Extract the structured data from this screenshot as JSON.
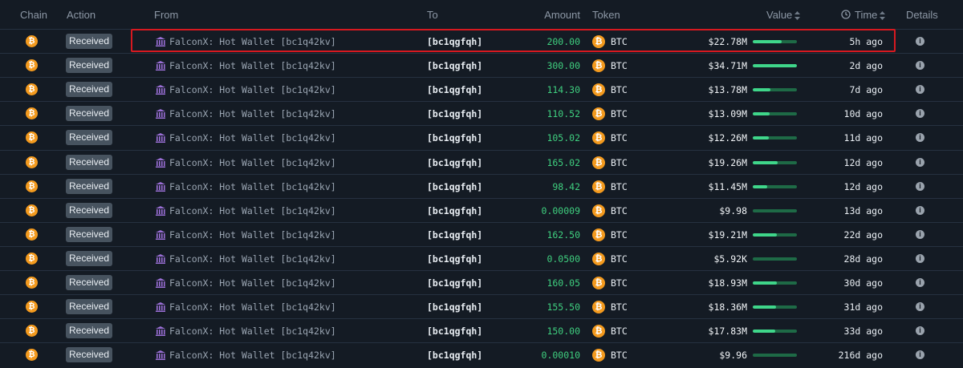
{
  "header": {
    "chain": "Chain",
    "action": "Action",
    "from": "From",
    "to": "To",
    "amount": "Amount",
    "token": "Token",
    "value": "Value",
    "time": "Time",
    "details": "Details"
  },
  "icons": {
    "btc_glyph": "₿",
    "info_glyph": "i"
  },
  "colors": {
    "background": "#141b24",
    "amount_green": "#3fcf7f",
    "btc_orange": "#f39a1e",
    "highlight_red": "#d71920",
    "bar_fill": "#3fd68a"
  },
  "rows": [
    {
      "action": "Received",
      "from": "FalconX: Hot Wallet [bc1q42kv]",
      "to": "[bc1qgfqh]",
      "amount": "200.00",
      "token": "BTC",
      "value": "$22.78M",
      "value_level": 0.66,
      "time": "5h ago"
    },
    {
      "action": "Received",
      "from": "FalconX: Hot Wallet [bc1q42kv]",
      "to": "[bc1qgfqh]",
      "amount": "300.00",
      "token": "BTC",
      "value": "$34.71M",
      "value_level": 1.0,
      "time": "2d ago"
    },
    {
      "action": "Received",
      "from": "FalconX: Hot Wallet [bc1q42kv]",
      "to": "[bc1qgfqh]",
      "amount": "114.30",
      "token": "BTC",
      "value": "$13.78M",
      "value_level": 0.4,
      "time": "7d ago"
    },
    {
      "action": "Received",
      "from": "FalconX: Hot Wallet [bc1q42kv]",
      "to": "[bc1qgfqh]",
      "amount": "110.52",
      "token": "BTC",
      "value": "$13.09M",
      "value_level": 0.38,
      "time": "10d ago"
    },
    {
      "action": "Received",
      "from": "FalconX: Hot Wallet [bc1q42kv]",
      "to": "[bc1qgfqh]",
      "amount": "105.02",
      "token": "BTC",
      "value": "$12.26M",
      "value_level": 0.36,
      "time": "11d ago"
    },
    {
      "action": "Received",
      "from": "FalconX: Hot Wallet [bc1q42kv]",
      "to": "[bc1qgfqh]",
      "amount": "165.02",
      "token": "BTC",
      "value": "$19.26M",
      "value_level": 0.56,
      "time": "12d ago"
    },
    {
      "action": "Received",
      "from": "FalconX: Hot Wallet [bc1q42kv]",
      "to": "[bc1qgfqh]",
      "amount": "98.42",
      "token": "BTC",
      "value": "$11.45M",
      "value_level": 0.33,
      "time": "12d ago"
    },
    {
      "action": "Received",
      "from": "FalconX: Hot Wallet [bc1q42kv]",
      "to": "[bc1qgfqh]",
      "amount": "0.00009",
      "token": "BTC",
      "value": "$9.98",
      "value_level": 0.0,
      "time": "13d ago"
    },
    {
      "action": "Received",
      "from": "FalconX: Hot Wallet [bc1q42kv]",
      "to": "[bc1qgfqh]",
      "amount": "162.50",
      "token": "BTC",
      "value": "$19.21M",
      "value_level": 0.55,
      "time": "22d ago"
    },
    {
      "action": "Received",
      "from": "FalconX: Hot Wallet [bc1q42kv]",
      "to": "[bc1qgfqh]",
      "amount": "0.0500",
      "token": "BTC",
      "value": "$5.92K",
      "value_level": 0.0,
      "time": "28d ago"
    },
    {
      "action": "Received",
      "from": "FalconX: Hot Wallet [bc1q42kv]",
      "to": "[bc1qgfqh]",
      "amount": "160.05",
      "token": "BTC",
      "value": "$18.93M",
      "value_level": 0.55,
      "time": "30d ago"
    },
    {
      "action": "Received",
      "from": "FalconX: Hot Wallet [bc1q42kv]",
      "to": "[bc1qgfqh]",
      "amount": "155.50",
      "token": "BTC",
      "value": "$18.36M",
      "value_level": 0.53,
      "time": "31d ago"
    },
    {
      "action": "Received",
      "from": "FalconX: Hot Wallet [bc1q42kv]",
      "to": "[bc1qgfqh]",
      "amount": "150.00",
      "token": "BTC",
      "value": "$17.83M",
      "value_level": 0.51,
      "time": "33d ago"
    },
    {
      "action": "Received",
      "from": "FalconX: Hot Wallet [bc1q42kv]",
      "to": "[bc1qgfqh]",
      "amount": "0.00010",
      "token": "BTC",
      "value": "$9.96",
      "value_level": 0.0,
      "time": "216d ago"
    }
  ]
}
